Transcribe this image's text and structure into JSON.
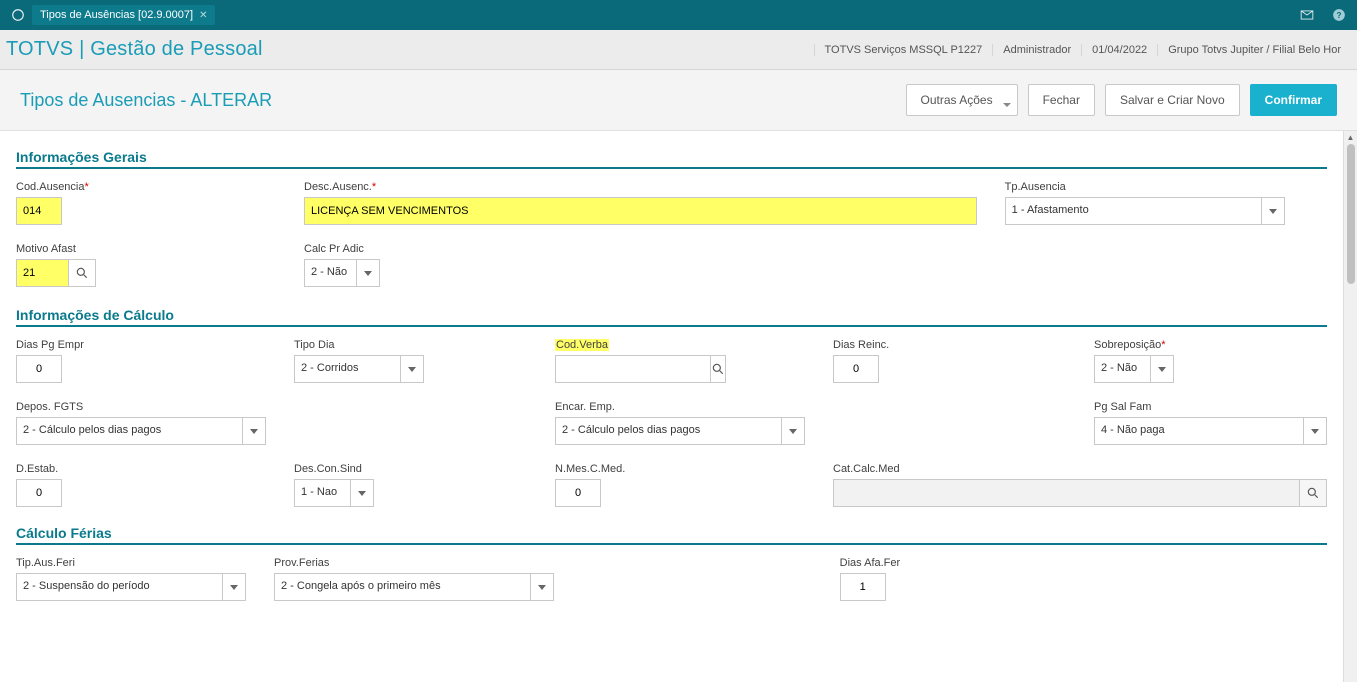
{
  "topbar": {
    "tab_title": "Tipos de Ausências [02.9.0007]"
  },
  "header": {
    "brand": "TOTVS | Gestão de Pessoal",
    "server": "TOTVS Serviços MSSQL P1227",
    "user": "Administrador",
    "date": "01/04/2022",
    "group": "Grupo Totvs Jupiter / Filial Belo Hor"
  },
  "subheader": {
    "title": "Tipos de Ausencias - ALTERAR",
    "btn_outras": "Outras Ações",
    "btn_fechar": "Fechar",
    "btn_salvar": "Salvar e Criar Novo",
    "btn_confirmar": "Confirmar"
  },
  "sections": {
    "gerais": "Informações Gerais",
    "calculo": "Informações de Cálculo",
    "ferias": "Cálculo Férias"
  },
  "fields": {
    "cod_ausencia": {
      "label": "Cod.Ausencia",
      "value": "014"
    },
    "desc_ausenc": {
      "label": "Desc.Ausenc.",
      "value": "LICENÇA SEM VENCIMENTOS"
    },
    "tp_ausencia": {
      "label": "Tp.Ausencia",
      "value": "1 - Afastamento"
    },
    "motivo_afast": {
      "label": "Motivo Afast",
      "value": "21"
    },
    "calc_pr_adic": {
      "label": "Calc Pr Adic",
      "value": "2 - Não"
    },
    "dias_pg_empr": {
      "label": "Dias Pg Empr",
      "value": "0"
    },
    "tipo_dia": {
      "label": "Tipo Dia",
      "value": "2 - Corridos"
    },
    "cod_verba": {
      "label": "Cod.Verba",
      "value": ""
    },
    "dias_reinc": {
      "label": "Dias Reinc.",
      "value": "0"
    },
    "sobreposicao": {
      "label": "Sobreposição",
      "value": "2 - Não"
    },
    "depos_fgts": {
      "label": "Depos. FGTS",
      "value": "2 - Cálculo pelos dias pagos"
    },
    "encar_emp": {
      "label": "Encar. Emp.",
      "value": "2 - Cálculo pelos dias pagos"
    },
    "pg_sal_fam": {
      "label": "Pg Sal Fam",
      "value": "4 - Não paga"
    },
    "d_estab": {
      "label": "D.Estab.",
      "value": "0"
    },
    "des_con_sind": {
      "label": "Des.Con.Sind",
      "value": "1 - Nao"
    },
    "n_mes_c_med": {
      "label": "N.Mes.C.Med.",
      "value": "0"
    },
    "cat_calc_med": {
      "label": "Cat.Calc.Med",
      "value": ""
    },
    "tip_aus_feri": {
      "label": "Tip.Aus.Feri",
      "value": "2 - Suspensão do período"
    },
    "prov_ferias": {
      "label": "Prov.Ferias",
      "value": "2 - Congela após o primeiro mês"
    },
    "dias_afa_fer": {
      "label": "Dias Afa.Fer",
      "value": "1"
    }
  }
}
